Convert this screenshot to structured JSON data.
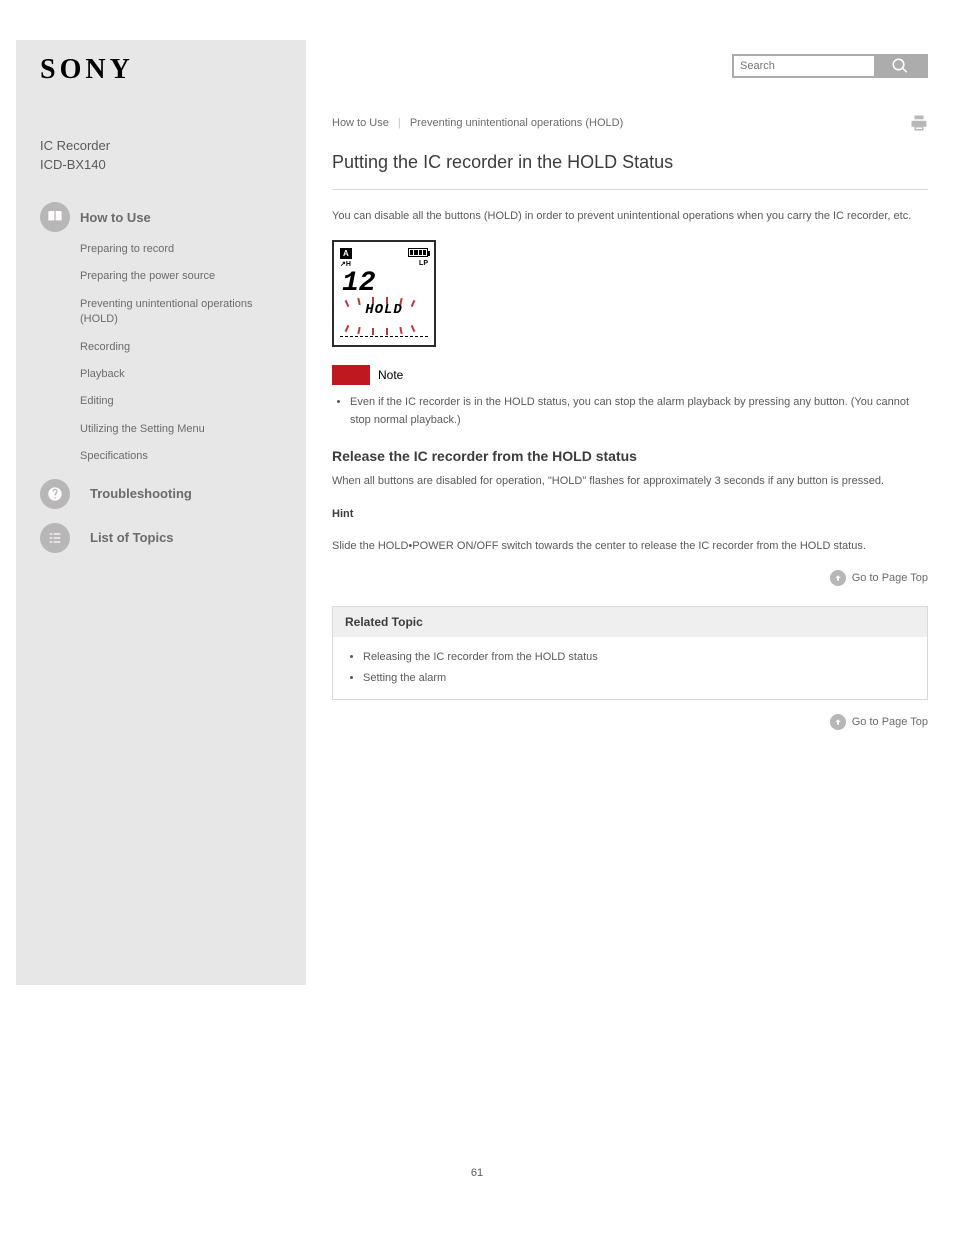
{
  "brand": "SONY",
  "product_title": "IC Recorder",
  "product_model": "ICD-BX140",
  "sidebar": {
    "howto_heading": "How to Use",
    "howto_links": [
      "Preparing to record",
      "Preparing the power source",
      "Preventing unintentional operations (HOLD)",
      "Recording",
      "Playback",
      "Editing",
      "Utilizing the Setting Menu",
      "Specifications"
    ],
    "trouble_heading": "Troubleshooting",
    "contents_heading": "List of Topics"
  },
  "search_placeholder": "Search",
  "breadcrumb": {
    "a": "How to Use",
    "b": "Preventing unintentional operations (HOLD)"
  },
  "icons": {
    "print": "Print"
  },
  "title": "Putting the IC recorder in the HOLD Status",
  "intro": "You can disable all the buttons (HOLD) in order to prevent unintentional operations when you carry the IC recorder, etc.",
  "note_label": "Note",
  "notes": [
    "Even if the IC recorder is in the HOLD status, you can stop the alarm playback by pressing any button. (You cannot stop normal playback.)"
  ],
  "release_heading": "Release the IC recorder from the HOLD status",
  "release_text_1": "When all buttons are disabled for operation, \"HOLD\" flashes for approximately 3 seconds if any button is pressed.",
  "release_text_2": "Slide the HOLD•POWER ON/OFF switch towards the center to release the IC recorder from the HOLD status.",
  "hint_label": "Hint",
  "goto_label": "Go to Page Top",
  "related_heading": "Related Topic",
  "related_items": [
    "Releasing the IC recorder from the HOLD status",
    "Setting the alarm"
  ],
  "page_number": "61"
}
